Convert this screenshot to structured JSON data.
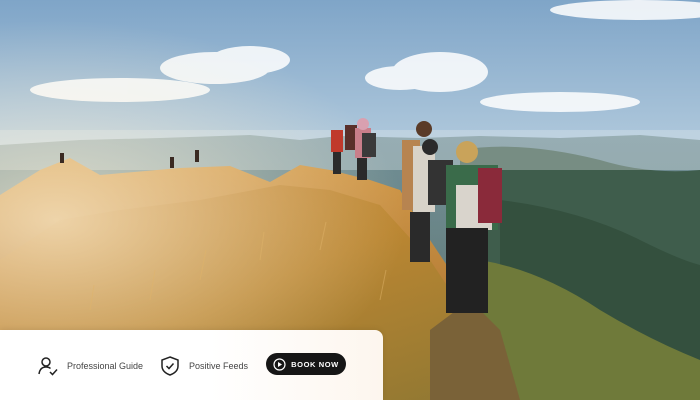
{
  "hero": {
    "scene": "hikers-on-mountain-ridge"
  },
  "features": [
    {
      "label": "Professional Guide",
      "icon": "user-check-icon"
    },
    {
      "label": "Positive Feeds",
      "icon": "shield-check-icon"
    }
  ],
  "cta": {
    "label": "BOOK NOW",
    "icon": "play-circle-icon"
  },
  "colors": {
    "button_bg": "#161616",
    "button_text": "#ffffff",
    "bar_bg": "#ffffff"
  }
}
